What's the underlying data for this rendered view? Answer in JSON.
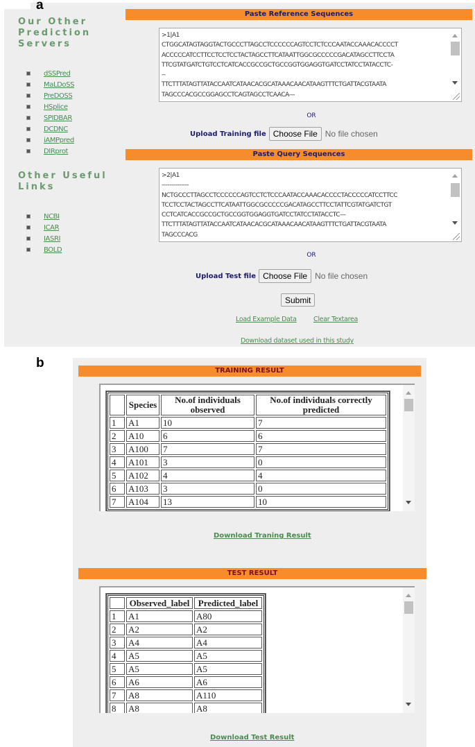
{
  "panel_labels": {
    "a": "a",
    "b": "b"
  },
  "sidebar": {
    "heading_servers_lines": [
      "Our Other",
      "Prediction",
      "Servers"
    ],
    "servers": [
      {
        "label": "dSSPred"
      },
      {
        "label": "MaLDoSS"
      },
      {
        "label": "PreDOSS"
      },
      {
        "label": "HSplice"
      },
      {
        "label": "SPIDBAR"
      },
      {
        "label": "DCDNC"
      },
      {
        "label": "iAMPpred"
      },
      {
        "label": "DIRprot"
      }
    ],
    "heading_links_lines": [
      "Other Useful",
      "Links"
    ],
    "links": [
      {
        "label": "NCBI"
      },
      {
        "label": "ICAR"
      },
      {
        "label": "IASRI"
      },
      {
        "label": "BOLD"
      }
    ]
  },
  "form": {
    "reference_header": "Paste Reference Sequences",
    "reference_text": ">1|A1\nCTGGCATAGTAGGTACTGCCCTTAGCCTCCCCCCAGTCCTCTCCCAATACCAAACACCCCT\nACCCCCATCCTTCCTCCTCCTACTAGCCTTCATAATTGGCGCCCCCGACATAGCCTTCCTA\nTTCGTATGATCTGTCCTCATCACCGCCGCTGCCGGTGGAGGTGATCCTATCCTATACCTC-\n--\nTTCTTTATAGTTATACCAATCATAACACGCATAAACAACATAAGTTTCTGATTACGTAATA\nTAGCCCACGCCGGAGCCTCAGTAGCCTCAACA---",
    "or_label": "OR",
    "upload_training_label": "Upload Training file",
    "choose_file_label": "Choose File",
    "no_file_text": "No file chosen",
    "query_header": "Paste Query Sequences",
    "query_text": ">2|A1\n--------------\nNCTGCCCTTAGCCTCCCCCCAGTCCTCTCCCAATACCAAACACCCCTACCCCCATCCTTCC\nTCCTCCTACTAGCCTTCATAATTGGCGCCCCCGACATAGCCTTCCTATTCGTATGATCTGT\nCCTCATCACCGCCGCTGCCGGTGGAGGTGATCCTATCCTATACCTC---\nTTCTTTATAGTTATACCAATCATAACACGCATAAACAACATAAGTTTCTGATTACGTAATA\nTAGCCCACG",
    "upload_test_label": "Upload Test file",
    "submit_label": "Submit",
    "load_example_label": "Load Example Data",
    "clear_label": "Clear Textarea",
    "download_dataset_label": "Download dataset used in this study"
  },
  "training_result": {
    "header": "TRAINING RESULT",
    "columns": [
      "",
      "Species",
      "No.of individuals observed",
      "No.of individuals correctly predicted"
    ],
    "rows": [
      [
        "1",
        "A1",
        "10",
        "7"
      ],
      [
        "2",
        "A10",
        "6",
        "6"
      ],
      [
        "3",
        "A100",
        "7",
        "7"
      ],
      [
        "4",
        "A101",
        "3",
        "0"
      ],
      [
        "5",
        "A102",
        "4",
        "4"
      ],
      [
        "6",
        "A103",
        "3",
        "0"
      ],
      [
        "7",
        "A104",
        "13",
        "10"
      ]
    ],
    "download_label": "Download Traning Result"
  },
  "test_result": {
    "header": "TEST RESULT",
    "columns": [
      "",
      "Observed_label",
      "Predicted_label"
    ],
    "rows": [
      [
        "1",
        "A1",
        "A80"
      ],
      [
        "2",
        "A2",
        "A2"
      ],
      [
        "3",
        "A4",
        "A4"
      ],
      [
        "4",
        "A5",
        "A5"
      ],
      [
        "5",
        "A5",
        "A5"
      ],
      [
        "6",
        "A6",
        "A6"
      ],
      [
        "7",
        "A8",
        "A110"
      ],
      [
        "8",
        "A8",
        "A8"
      ]
    ],
    "download_label": "Download Test Result"
  },
  "colors": {
    "header_bar": "#f88b2a",
    "link_green": "#4a8a4e",
    "heading_green": "#6b9a6e",
    "navy_text": "#1c1c6e",
    "maroon_text": "#7a1020",
    "panel_bg": "#eeeeee"
  }
}
